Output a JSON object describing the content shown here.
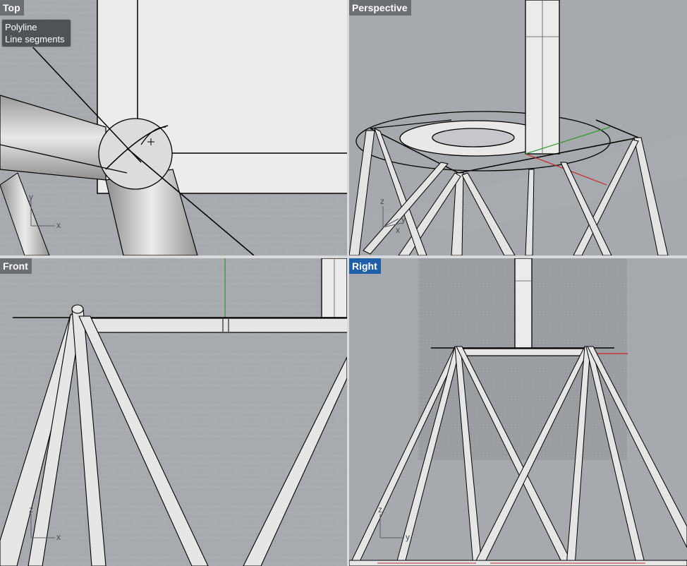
{
  "viewports": {
    "top": {
      "label": "Top"
    },
    "perspective": {
      "label": "Perspective"
    },
    "front": {
      "label": "Front"
    },
    "right": {
      "label": "Right"
    }
  },
  "tooltip": {
    "line1": "Polyline",
    "line2": "Line segments"
  },
  "axes": {
    "x": "x",
    "y": "y",
    "z": "z"
  },
  "colors": {
    "viewport_bg": "#a6a9ad",
    "active_tab": "#1f5fa8",
    "inactive_tab": "#6b6e73",
    "tube": "#e6e6e6",
    "curve": "#000000"
  }
}
